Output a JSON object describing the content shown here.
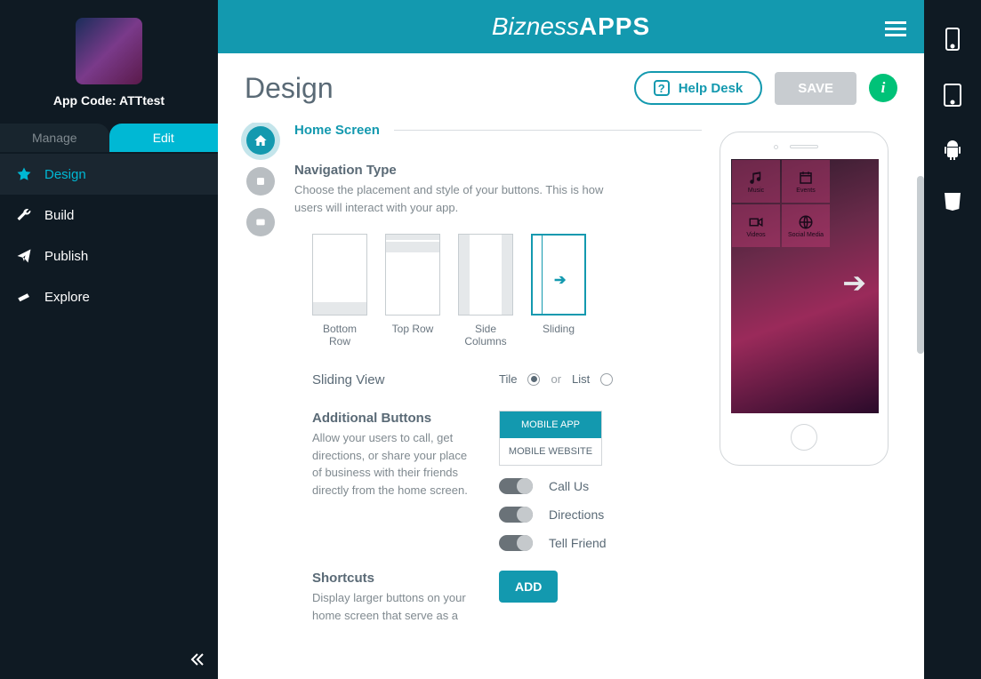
{
  "sidebar": {
    "app_code_label": "App Code: ATTtest",
    "tabs": {
      "manage": "Manage",
      "edit": "Edit"
    },
    "nav": [
      {
        "label": "Design"
      },
      {
        "label": "Build"
      },
      {
        "label": "Publish"
      },
      {
        "label": "Explore"
      }
    ]
  },
  "brand": {
    "first": "Bizness",
    "second": "APPS"
  },
  "header": {
    "title": "Design",
    "help": "Help Desk",
    "save": "SAVE"
  },
  "section": {
    "title": "Home Screen",
    "nav_type": {
      "heading": "Navigation Type",
      "desc": "Choose the placement and style of your buttons. This is how users will interact with your app.",
      "options": [
        "Bottom Row",
        "Top Row",
        "Side Columns",
        "Sliding"
      ],
      "selected": "Sliding"
    },
    "sliding_view": {
      "label": "Sliding View",
      "tile": "Tile",
      "or": "or",
      "list": "List"
    },
    "additional": {
      "heading": "Additional Buttons",
      "desc": "Allow your users to call, get directions, or share your place of business with their friends directly from the home screen.",
      "tabs": [
        "MOBILE APP",
        "MOBILE WEBSITE"
      ],
      "toggles": [
        "Call Us",
        "Directions",
        "Tell Friend"
      ]
    },
    "shortcuts": {
      "heading": "Shortcuts",
      "desc": "Display larger buttons on your home screen that serve as a",
      "add": "ADD"
    }
  },
  "preview": {
    "tiles": [
      "Music",
      "Events",
      "Videos",
      "Social Media"
    ]
  }
}
